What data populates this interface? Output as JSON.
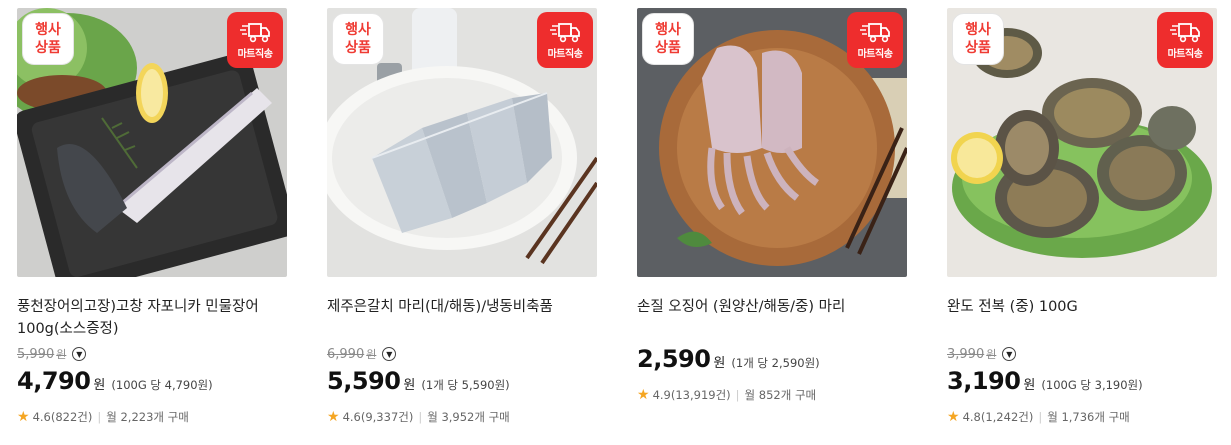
{
  "badges": {
    "event_line1": "행사",
    "event_line2": "상품",
    "mart": "마트직송"
  },
  "products": [
    {
      "name": "풍천장어의고장)고창 자포니카 민물장어 100g(소스증정)",
      "original_price": "5,990",
      "original_unit": "원",
      "price": "4,790",
      "price_unit": "원",
      "unit_price": "(100G 당 4,790원)",
      "rating": "4.6(822건)",
      "monthly": "월 2,223개 구매"
    },
    {
      "name": "제주은갈치 마리(대/해동)/냉동비축품",
      "original_price": "6,990",
      "original_unit": "원",
      "price": "5,590",
      "price_unit": "원",
      "unit_price": "(1개 당 5,590원)",
      "rating": "4.6(9,337건)",
      "monthly": "월 3,952개 구매"
    },
    {
      "name": "손질 오징어 (원양산/해동/중) 마리",
      "original_price": "",
      "original_unit": "",
      "price": "2,590",
      "price_unit": "원",
      "unit_price": "(1개 당 2,590원)",
      "rating": "4.9(13,919건)",
      "monthly": "월 852개 구매"
    },
    {
      "name": "완도 전복 (중) 100G",
      "original_price": "3,990",
      "original_unit": "원",
      "price": "3,190",
      "price_unit": "원",
      "unit_price": "(100G 당 3,190원)",
      "rating": "4.8(1,242건)",
      "monthly": "월 1,736개 구매"
    }
  ],
  "icons": {
    "dropdown": "chevron-down-icon",
    "rating": "star-icon",
    "delivery": "truck-icon"
  },
  "colors": {
    "badge_red": "#ee2d2d",
    "star": "#f5a623",
    "text_muted": "#8a8a8a"
  }
}
